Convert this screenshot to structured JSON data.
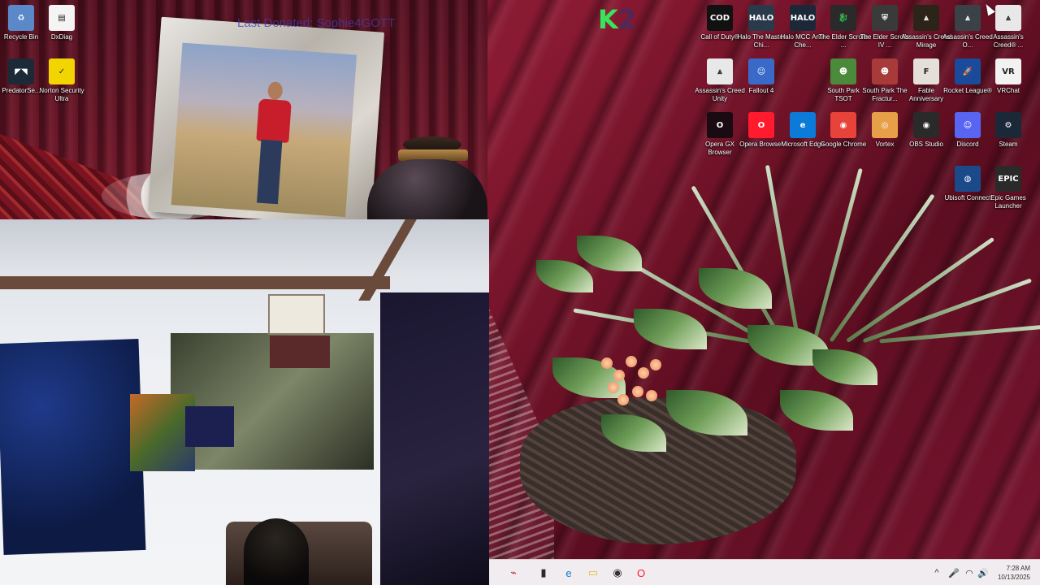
{
  "watermark_text": "Last Donated: Sophie4GOTT",
  "logo": {
    "k": "K",
    "two": "2"
  },
  "desktop_icons_left": [
    {
      "id": "recycle-bin",
      "label": "Recycle Bin",
      "glyph": "♻",
      "color": "#5a88c8"
    },
    {
      "id": "dxdiag",
      "label": "DxDiag",
      "glyph": "▤",
      "color": "#f4f4f4"
    },
    {
      "id": "predatorsense",
      "label": "PredatorSe...",
      "glyph": "◤◥",
      "color": "#1c2a38"
    },
    {
      "id": "norton",
      "label": "Norton Security Ultra",
      "glyph": "✓",
      "color": "#f2d400"
    }
  ],
  "desktop_icons_right": [
    {
      "id": "call-of-duty",
      "label": "Call of Duty®",
      "glyph": "COD",
      "color": "#111111"
    },
    {
      "id": "halo-master-chief",
      "label": "Halo The Master Chi...",
      "glyph": "HALO",
      "color": "#2a3a4a"
    },
    {
      "id": "halo-mcc",
      "label": "Halo MCC Anti-Che...",
      "glyph": "HALO",
      "color": "#1c2838"
    },
    {
      "id": "elder-scrolls-1",
      "label": "The Elder Scrolls ...",
      "glyph": "🐉",
      "color": "#2a2a2a"
    },
    {
      "id": "elder-scrolls-iv",
      "label": "The Elder Scrolls IV ...",
      "glyph": "⛨",
      "color": "#3a3a3a"
    },
    {
      "id": "ac-mirage",
      "label": "Assassin's Creed Mirage",
      "glyph": "⩓",
      "color": "#2c2418"
    },
    {
      "id": "ac-odyssey",
      "label": "Assassin's Creed O...",
      "glyph": "⩓",
      "color": "#3a4248"
    },
    {
      "id": "ac-3",
      "label": "Assassin's Creed® ...",
      "glyph": "⩓",
      "color": "#e8e8e8"
    },
    {
      "id": "ac-unity",
      "label": "Assassin's Creed Unity",
      "glyph": "⩓",
      "color": "#e8e8e8"
    },
    {
      "id": "fallout-4",
      "label": "Fallout 4",
      "glyph": "☺",
      "color": "#3a6ac8"
    },
    {
      "id": "south-park-tsot",
      "label": "South Park TSOT",
      "glyph": "☻",
      "color": "#4a8a3a"
    },
    {
      "id": "south-park-fractured",
      "label": "South Park The Fractur...",
      "glyph": "☻",
      "color": "#a83a3a"
    },
    {
      "id": "fable-anniversary",
      "label": "Fable Anniversary",
      "glyph": "F",
      "color": "#e4e0d8"
    },
    {
      "id": "rocket-league",
      "label": "Rocket League®",
      "glyph": "🚀",
      "color": "#1a4a9a"
    },
    {
      "id": "vrchat",
      "label": "VRChat",
      "glyph": "VR",
      "color": "#f2f2f2"
    },
    {
      "id": "opera-gx",
      "label": "Opera GX Browser",
      "glyph": "O",
      "color": "#1a0a12"
    },
    {
      "id": "opera-browser",
      "label": "Opera Browser",
      "glyph": "O",
      "color": "#ff1b2d"
    },
    {
      "id": "microsoft-edge",
      "label": "Microsoft Edge",
      "glyph": "e",
      "color": "#0c7ad8"
    },
    {
      "id": "google-chrome",
      "label": "Google Chrome",
      "glyph": "◉",
      "color": "#e8433a"
    },
    {
      "id": "vortex",
      "label": "Vortex",
      "glyph": "◎",
      "color": "#e8a048"
    },
    {
      "id": "obs-studio",
      "label": "OBS Studio",
      "glyph": "◉",
      "color": "#2a2a2a"
    },
    {
      "id": "discord",
      "label": "Discord",
      "glyph": "☺",
      "color": "#5865f2"
    },
    {
      "id": "steam",
      "label": "Steam",
      "glyph": "⚙",
      "color": "#1b2838"
    },
    {
      "id": "ubisoft-connect",
      "label": "Ubisoft Connect",
      "glyph": "◍",
      "color": "#1a4a8a"
    },
    {
      "id": "epic-games",
      "label": "Epic Games Launcher",
      "glyph": "EPIC",
      "color": "#2a2a2a"
    }
  ],
  "taskbar": {
    "items": [
      {
        "id": "start",
        "glyph": "⌁",
        "color": "#c8283a"
      },
      {
        "id": "task-view",
        "glyph": "▮",
        "color": "#2a2a2a"
      },
      {
        "id": "edge",
        "glyph": "e",
        "color": "#0c7ad8"
      },
      {
        "id": "file-explorer",
        "glyph": "▭",
        "color": "#e8b830"
      },
      {
        "id": "chrome-app",
        "glyph": "◉",
        "color": "#333333"
      },
      {
        "id": "opera",
        "glyph": "O",
        "color": "#ff1b2d"
      }
    ],
    "tray": {
      "chevron": "^",
      "mic": "🎤",
      "wifi": "◠",
      "volume": "🔊",
      "time": "7:28 AM",
      "date": "10/13/2025"
    }
  }
}
